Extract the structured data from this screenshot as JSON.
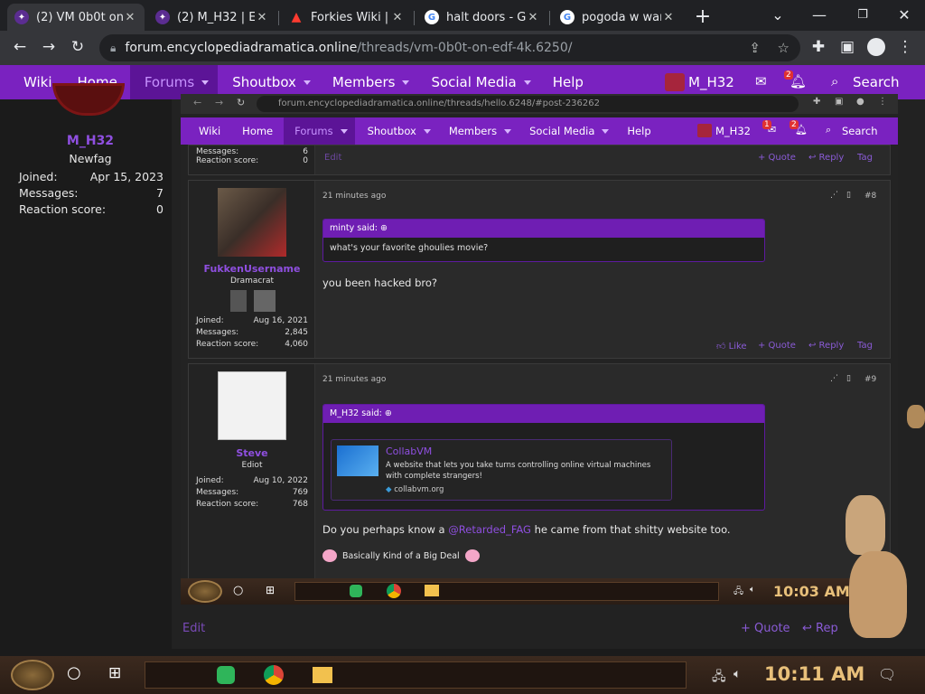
{
  "browser": {
    "tabs": [
      {
        "label": "(2) VM 0b0t on",
        "favicon": "forum-icon",
        "active": true
      },
      {
        "label": "(2) M_H32 | E",
        "favicon": "forum-icon",
        "active": false
      },
      {
        "label": "Forkies Wiki |",
        "favicon": "fire-icon",
        "active": false
      },
      {
        "label": "halt doors - Go",
        "favicon": "google-icon",
        "active": false
      },
      {
        "label": "pogoda w wars",
        "favicon": "google-icon",
        "active": false
      }
    ],
    "new_tab": "+",
    "url_host": "forum.encyclopediadramatica.online",
    "url_path": "/threads/vm-0b0t-on-edf-4k.6250/"
  },
  "forum_nav": {
    "items": [
      "Wiki",
      "Home",
      "Forums",
      "Shoutbox",
      "Members",
      "Social Media",
      "Help"
    ],
    "current": "Forums",
    "username": "M_H32",
    "search": "Search",
    "alerts_badge": "2"
  },
  "left_user": {
    "name": "M_H32",
    "title": "Newfag",
    "stats": [
      {
        "label": "Joined:",
        "value": "Apr 15, 2023"
      },
      {
        "label": "Messages:",
        "value": "7"
      },
      {
        "label": "Reaction score:",
        "value": "0"
      }
    ]
  },
  "left_actions": {
    "edit": "Edit",
    "quote": "+ Quote",
    "reply": "Rep"
  },
  "inner": {
    "url": "forum.encyclopediadramatica.online/threads/hello.6248/#post-236262",
    "nav_items": [
      "Wiki",
      "Home",
      "Forums",
      "Shoutbox",
      "Members",
      "Social Media",
      "Help"
    ],
    "current": "Forums",
    "username": "M_H32",
    "search": "Search",
    "inbox_badge": "1",
    "alerts_badge": "2",
    "top_stats": [
      {
        "label": "Messages:",
        "value": "6"
      },
      {
        "label": "Reaction score:",
        "value": "0"
      }
    ],
    "top_edit": "Edit",
    "top_actions": [
      "+ Quote",
      "↩ Reply",
      "Tag"
    ],
    "posts": [
      {
        "username": "FukkenUsername",
        "user_title": "Dramacrat",
        "stats": [
          {
            "label": "Joined:",
            "value": "Aug 16, 2021"
          },
          {
            "label": "Messages:",
            "value": "2,845"
          },
          {
            "label": "Reaction score:",
            "value": "4,060"
          }
        ],
        "time": "21 minutes ago",
        "number": "#8",
        "quote_author": "minty said:",
        "quote_text": "what's your favorite ghoulies movie?",
        "body": "you been hacked bro?",
        "actions": [
          "Like",
          "+ Quote",
          "↩ Reply",
          "Tag"
        ]
      },
      {
        "username": "Steve",
        "user_title": "Ediot",
        "stats": [
          {
            "label": "Joined:",
            "value": "Aug 10, 2022"
          },
          {
            "label": "Messages:",
            "value": "769"
          },
          {
            "label": "Reaction score:",
            "value": "768"
          }
        ],
        "time": "21 minutes ago",
        "number": "#9",
        "quote_author": "M_H32 said:",
        "embed_title": "CollabVM",
        "embed_desc": "A website that lets you take turns controlling online virtual machines with complete strangers!",
        "embed_site": "collabvm.org",
        "body_pre": "Do you perhaps know a ",
        "body_mention": "@Retarded_FAG",
        "body_post": " he came from that shitty website too.",
        "signature": "Basically Kind of a Big Deal"
      }
    ],
    "taskbar_time": "10:03 AM"
  },
  "taskbar": {
    "time": "10:11 AM"
  },
  "colors": {
    "accent": "#7a22c0",
    "accent_dark": "#5c1497",
    "link": "#8f4fe0"
  }
}
